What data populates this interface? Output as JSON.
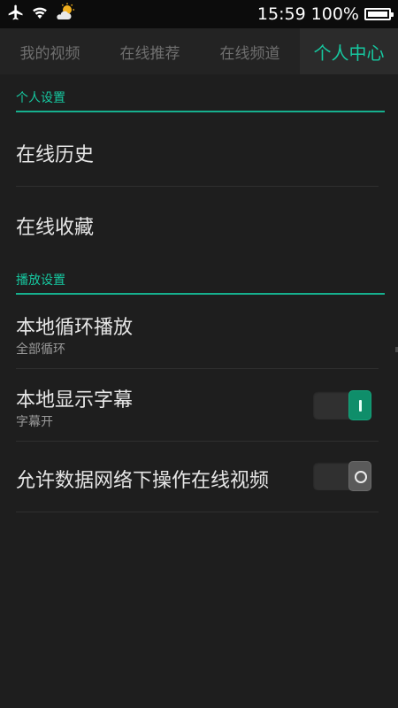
{
  "status_bar": {
    "time": "15:59",
    "battery_percent": "100%",
    "battery_level": 1.0,
    "icons": [
      "airplane-icon",
      "wifi-icon",
      "weather-icon"
    ]
  },
  "tabs": [
    {
      "label": "我的视频",
      "active": false
    },
    {
      "label": "在线推荐",
      "active": false
    },
    {
      "label": "在线频道",
      "active": false
    },
    {
      "label": "个人中心",
      "active": true
    }
  ],
  "sections": {
    "personal": {
      "header": "个人设置",
      "items": [
        {
          "title": "在线历史"
        },
        {
          "title": "在线收藏"
        }
      ]
    },
    "playback": {
      "header": "播放设置",
      "items": [
        {
          "title": "本地循环播放",
          "subtitle": "全部循环"
        },
        {
          "title": "本地显示字幕",
          "subtitle": "字幕开",
          "toggle": "on"
        },
        {
          "title": "允许数据网络下操作在线视频",
          "toggle": "off"
        }
      ]
    }
  },
  "colors": {
    "accent": "#16c8a0",
    "background": "#1e1e1e",
    "toggle_on": "#0f8e6a"
  }
}
